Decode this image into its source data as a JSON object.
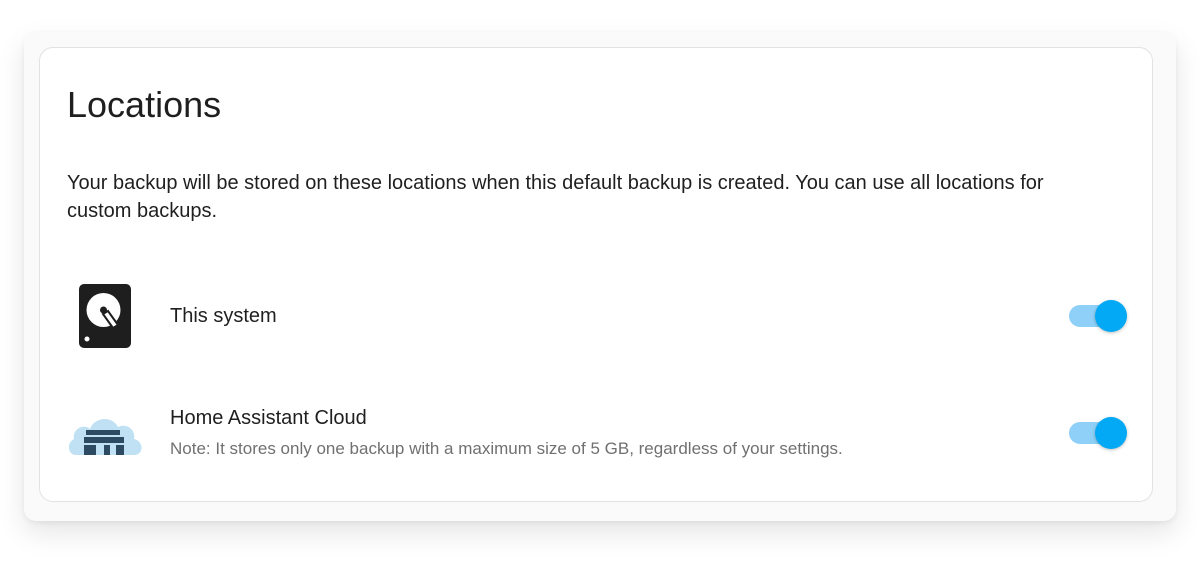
{
  "section": {
    "title": "Locations",
    "description": "Your backup will be stored on these locations when this default backup is created. You can use all locations for custom backups."
  },
  "locations": [
    {
      "icon": "hard-drive-icon",
      "title": "This system",
      "note": "",
      "enabled": true
    },
    {
      "icon": "cloud-icon",
      "title": "Home Assistant Cloud",
      "note": "Note: It stores only one backup with a maximum size of 5 GB, regardless of your settings.",
      "enabled": true
    }
  ],
  "colors": {
    "accent": "#03a9f4",
    "accent_track": "#8ed0f7",
    "text_primary": "#1f1f1f",
    "text_secondary": "#707070",
    "cloud_light": "#bfe1f3",
    "cloud_house": "#2d4a63"
  }
}
